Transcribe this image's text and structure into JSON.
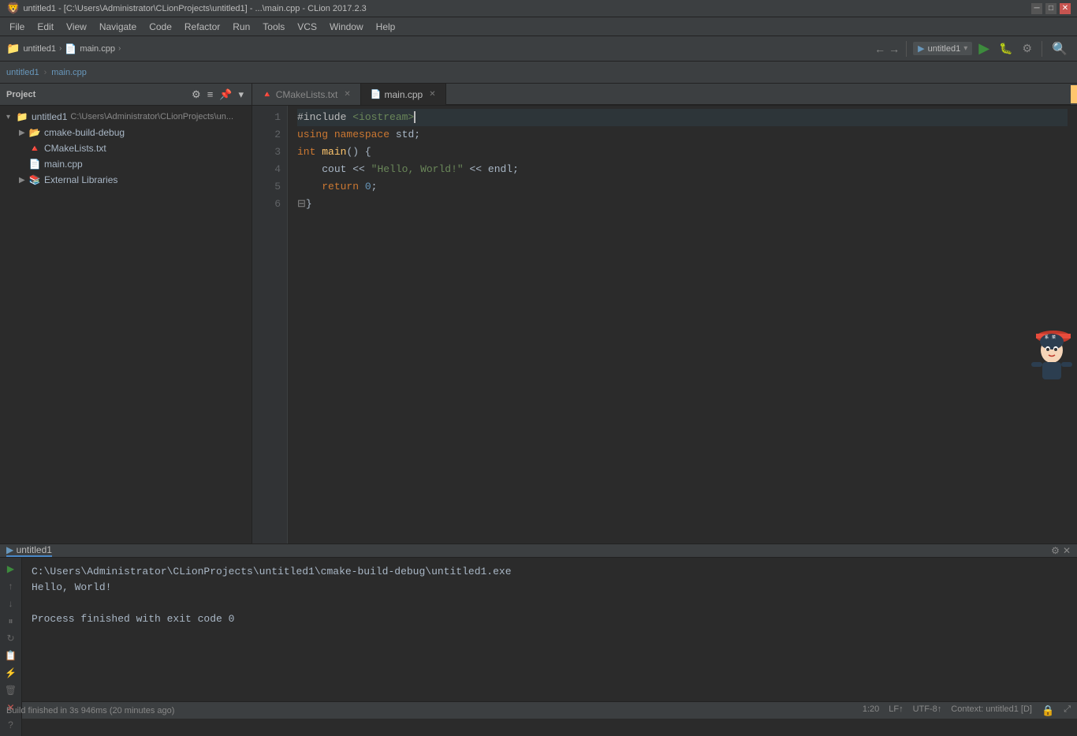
{
  "titlebar": {
    "title": "untitled1 - [C:\\Users\\Administrator\\CLionProjects\\untitled1] - ...\\main.cpp - CLion 2017.2.3",
    "icon": "clion",
    "controls": [
      "minimize",
      "maximize",
      "close"
    ]
  },
  "menubar": {
    "items": [
      "File",
      "Edit",
      "View",
      "Navigate",
      "Code",
      "Refactor",
      "Run",
      "Tools",
      "VCS",
      "Window",
      "Help"
    ]
  },
  "toolbar": {
    "project_label": "untitled1",
    "run_label": "▶",
    "debug_label": "🐛",
    "stop_label": "⏹",
    "config_label": "untitled1",
    "chevron_down": "▾"
  },
  "navbar": {
    "breadcrumbs": [
      "untitled1",
      "main.cpp"
    ]
  },
  "sidebar": {
    "title": "Project",
    "items": [
      {
        "label": "untitled1",
        "path": "C:\\Users\\Administrator\\CLionProjects\\un...",
        "type": "root",
        "expanded": true,
        "indent": 0
      },
      {
        "label": "cmake-build-debug",
        "type": "folder",
        "expanded": false,
        "indent": 1
      },
      {
        "label": "CMakeLists.txt",
        "type": "cmake",
        "indent": 1
      },
      {
        "label": "main.cpp",
        "type": "cpp",
        "indent": 1
      },
      {
        "label": "External Libraries",
        "type": "library",
        "indent": 1
      }
    ]
  },
  "tabs": [
    {
      "label": "CMakeLists.txt",
      "type": "cmake",
      "active": false
    },
    {
      "label": "main.cpp",
      "type": "cpp",
      "active": true
    }
  ],
  "editor": {
    "lines": [
      {
        "num": 1,
        "code": "#include <iostream>",
        "type": "preprocessor"
      },
      {
        "num": 2,
        "code": "using namespace std;",
        "type": "using"
      },
      {
        "num": 3,
        "code": "int main() {",
        "type": "main"
      },
      {
        "num": 4,
        "code": "    cout << \"Hello, World!\" << endl;",
        "type": "cout"
      },
      {
        "num": 5,
        "code": "    return 0;",
        "type": "return"
      },
      {
        "num": 6,
        "code": "}",
        "type": "bracket"
      }
    ]
  },
  "run_panel": {
    "tab_label": "untitled1",
    "tab_icon": "▶",
    "output": [
      "C:\\Users\\Administrator\\CLionProjects\\untitled1\\cmake-build-debug\\untitled1.exe",
      "Hello, World!",
      "",
      "Process finished with exit code 0"
    ]
  },
  "statusbar": {
    "build_text": "Build finished in 3s 946ms (20 minutes ago)",
    "line_col": "1:20",
    "line_separator": "LF↑",
    "encoding": "UTF-8↑",
    "context": "Context: untitled1 [D]",
    "lock_icon": "🔒",
    "expand_icon": "⤢"
  }
}
